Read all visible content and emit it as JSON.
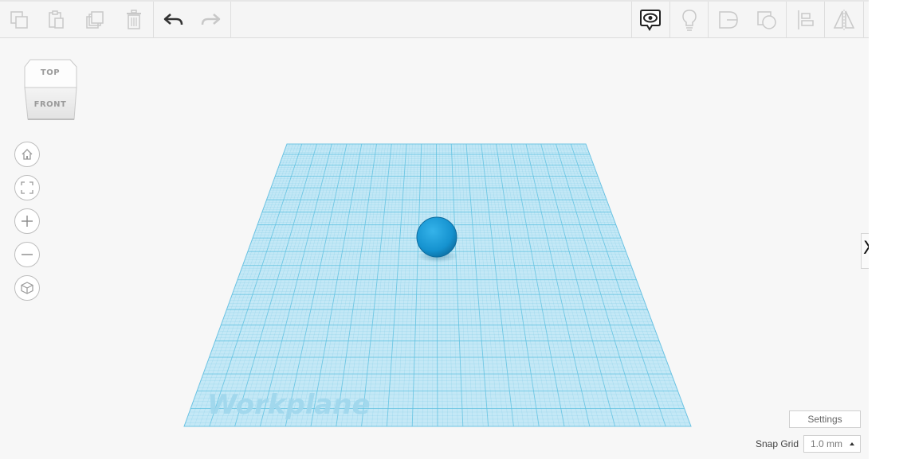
{
  "toolbar": {
    "left_tools": [
      {
        "name": "copy-icon",
        "enabled": false
      },
      {
        "name": "paste-icon",
        "enabled": false
      },
      {
        "name": "duplicate-icon",
        "enabled": false
      },
      {
        "name": "delete-icon",
        "enabled": false
      },
      {
        "name": "undo-icon",
        "enabled": true
      },
      {
        "name": "redo-icon",
        "enabled": false
      }
    ],
    "right_tools": [
      {
        "name": "show-all-icon",
        "enabled": true
      },
      {
        "name": "notes-lightbulb-icon",
        "enabled": false
      },
      {
        "name": "group-icon",
        "enabled": false
      },
      {
        "name": "ungroup-icon",
        "enabled": false
      },
      {
        "name": "align-icon",
        "enabled": false
      },
      {
        "name": "mirror-icon",
        "enabled": false
      }
    ]
  },
  "viewcube": {
    "top_label": "TOP",
    "front_label": "FRONT"
  },
  "nav_controls": [
    "home-view-icon",
    "fit-view-icon",
    "zoom-in-icon",
    "zoom-out-icon",
    "perspective-icon"
  ],
  "workplane": {
    "label": "Workplane",
    "grid_color": "#5bbfe0",
    "fill_color": "#bfe6f5"
  },
  "shape": {
    "type": "sphere",
    "color": "#1a9ad6"
  },
  "right_panel_toggle": {
    "glyph": "X"
  },
  "settings": {
    "label": "Settings"
  },
  "snap_grid": {
    "label": "Snap Grid",
    "value": "1.0 mm"
  },
  "colors": {
    "accent": "#1a9ad6",
    "toolbar_bg": "#f5f5f5",
    "canvas_bg": "#f7f7f7"
  }
}
